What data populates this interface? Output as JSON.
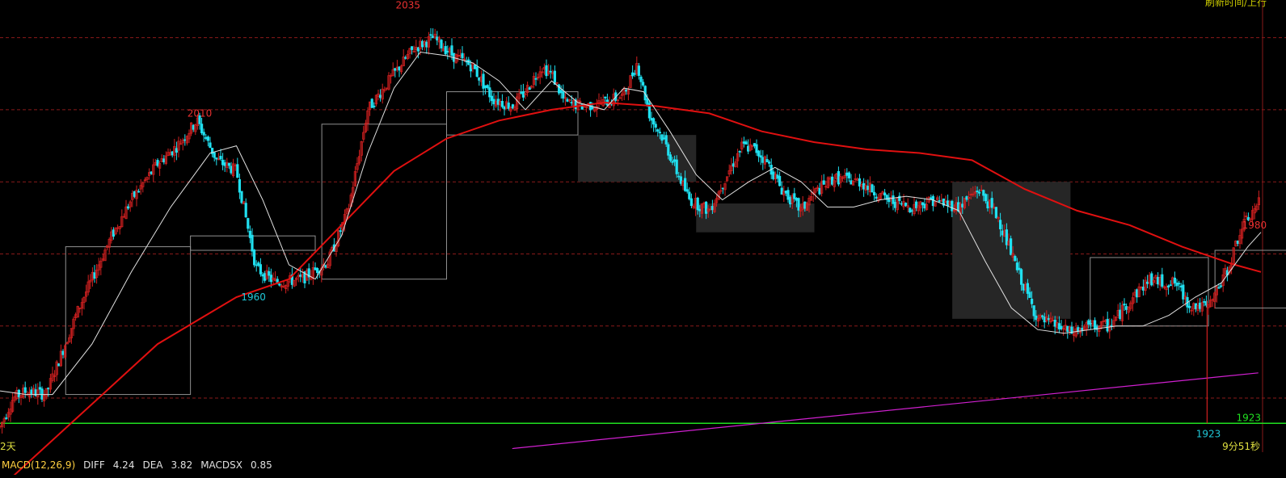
{
  "header": {
    "right_text": "刷新时间/上行"
  },
  "footer": {
    "period_label": "2天",
    "countdown": "9分51秒"
  },
  "macd": {
    "title": "MACD(12,26,9)",
    "diff_label": "DIFF",
    "diff_value": "4.24",
    "dea_label": "DEA",
    "dea_value": "3.82",
    "macdsx_label": "MACDSX",
    "macdsx_value": "0.85"
  },
  "chart_data": {
    "type": "candlestick",
    "annotations": [
      {
        "text": "2035",
        "kind": "high",
        "color": "#e83030"
      },
      {
        "text": "2010",
        "kind": "high",
        "color": "#e83030"
      },
      {
        "text": "1960",
        "kind": "low",
        "color": "#20c8d8"
      },
      {
        "text": "1980",
        "kind": "high",
        "color": "#e83030"
      },
      {
        "text": "1923",
        "kind": "low",
        "color": "#20c8d8"
      }
    ],
    "support_label": "1923",
    "colors": {
      "up": "#d02020",
      "down": "#20e0f0",
      "ma_short": "#e0e0e0",
      "ma_long": "#e01010",
      "trend": "#d020d0",
      "support": "#20e020",
      "grid": "#8a1a1a",
      "box": "#909090",
      "shade": "#262626"
    },
    "ylim": [
      1915,
      2040
    ],
    "support_value": 1923,
    "grid_values": [
      2030,
      2010,
      1990,
      1970,
      1950,
      1930
    ],
    "anchors": [
      [
        0,
        1922
      ],
      [
        10,
        1930
      ],
      [
        20,
        1932
      ],
      [
        35,
        1931
      ],
      [
        60,
        1955
      ],
      [
        85,
        1975
      ],
      [
        100,
        1985
      ],
      [
        120,
        1995
      ],
      [
        135,
        2000
      ],
      [
        150,
        2007
      ],
      [
        165,
        1996
      ],
      [
        180,
        1993
      ],
      [
        195,
        1966
      ],
      [
        210,
        1962
      ],
      [
        230,
        1963
      ],
      [
        250,
        1968
      ],
      [
        265,
        1982
      ],
      [
        280,
        2010
      ],
      [
        300,
        2020
      ],
      [
        315,
        2027
      ],
      [
        330,
        2030
      ],
      [
        345,
        2025
      ],
      [
        360,
        2022
      ],
      [
        375,
        2013
      ],
      [
        390,
        2011
      ],
      [
        400,
        2015
      ],
      [
        412,
        2022
      ],
      [
        420,
        2020
      ],
      [
        430,
        2012
      ],
      [
        445,
        2011
      ],
      [
        460,
        2012
      ],
      [
        475,
        2014
      ],
      [
        485,
        2023
      ],
      [
        495,
        2008
      ],
      [
        505,
        2002
      ],
      [
        515,
        1993
      ],
      [
        525,
        1985
      ],
      [
        540,
        1982
      ],
      [
        555,
        1993
      ],
      [
        565,
        2000
      ],
      [
        575,
        1999
      ],
      [
        585,
        1995
      ],
      [
        595,
        1988
      ],
      [
        610,
        1982
      ],
      [
        620,
        1987
      ],
      [
        635,
        1991
      ],
      [
        655,
        1990
      ],
      [
        675,
        1985
      ],
      [
        695,
        1983
      ],
      [
        710,
        1985
      ],
      [
        730,
        1983
      ],
      [
        745,
        1988
      ],
      [
        760,
        1980
      ],
      [
        775,
        1965
      ],
      [
        790,
        1952
      ],
      [
        805,
        1950
      ],
      [
        815,
        1948
      ],
      [
        830,
        1950
      ],
      [
        845,
        1950
      ],
      [
        860,
        1957
      ],
      [
        875,
        1963
      ],
      [
        885,
        1962
      ],
      [
        895,
        1962
      ],
      [
        905,
        1956
      ],
      [
        920,
        1955
      ],
      [
        935,
        1966
      ],
      [
        945,
        1977
      ],
      [
        960,
        1985
      ]
    ],
    "ma_short": [
      [
        0,
        1932
      ],
      [
        20,
        1931
      ],
      [
        40,
        1931
      ],
      [
        70,
        1945
      ],
      [
        100,
        1965
      ],
      [
        130,
        1983
      ],
      [
        160,
        1998
      ],
      [
        180,
        2000
      ],
      [
        200,
        1985
      ],
      [
        220,
        1967
      ],
      [
        240,
        1963
      ],
      [
        260,
        1975
      ],
      [
        280,
        1998
      ],
      [
        300,
        2016
      ],
      [
        320,
        2026
      ],
      [
        340,
        2025
      ],
      [
        360,
        2023
      ],
      [
        380,
        2018
      ],
      [
        400,
        2010
      ],
      [
        420,
        2018
      ],
      [
        440,
        2012
      ],
      [
        460,
        2010
      ],
      [
        475,
        2016
      ],
      [
        490,
        2015
      ],
      [
        510,
        2004
      ],
      [
        530,
        1992
      ],
      [
        550,
        1985
      ],
      [
        570,
        1990
      ],
      [
        590,
        1994
      ],
      [
        610,
        1990
      ],
      [
        630,
        1983
      ],
      [
        650,
        1983
      ],
      [
        670,
        1985
      ],
      [
        690,
        1986
      ],
      [
        710,
        1985
      ],
      [
        730,
        1982
      ],
      [
        750,
        1968
      ],
      [
        770,
        1955
      ],
      [
        790,
        1949
      ],
      [
        810,
        1948
      ],
      [
        830,
        1949
      ],
      [
        850,
        1950
      ],
      [
        870,
        1950
      ],
      [
        890,
        1953
      ],
      [
        910,
        1958
      ],
      [
        930,
        1962
      ],
      [
        950,
        1972
      ],
      [
        960,
        1976
      ]
    ],
    "ma_long": [
      [
        0,
        1905
      ],
      [
        60,
        1925
      ],
      [
        120,
        1945
      ],
      [
        180,
        1958
      ],
      [
        220,
        1963
      ],
      [
        260,
        1978
      ],
      [
        300,
        1993
      ],
      [
        340,
        2002
      ],
      [
        380,
        2007
      ],
      [
        420,
        2010
      ],
      [
        460,
        2012
      ],
      [
        500,
        2011
      ],
      [
        540,
        2009
      ],
      [
        580,
        2004
      ],
      [
        620,
        2001
      ],
      [
        660,
        1999
      ],
      [
        700,
        1998
      ],
      [
        740,
        1996
      ],
      [
        780,
        1988
      ],
      [
        820,
        1982
      ],
      [
        860,
        1978
      ],
      [
        900,
        1972
      ],
      [
        940,
        1967
      ],
      [
        960,
        1965
      ]
    ]
  }
}
